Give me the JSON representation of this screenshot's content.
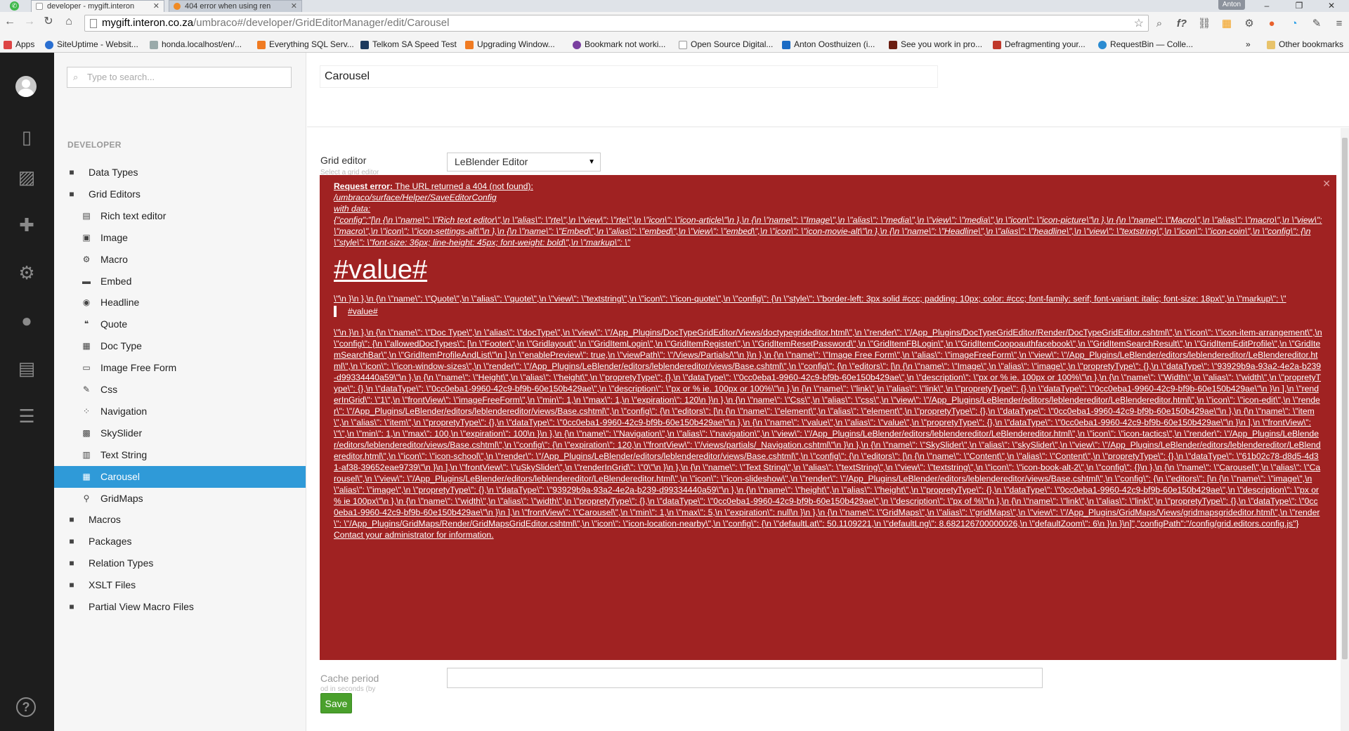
{
  "browser": {
    "tabs": [
      {
        "title": "developer - mygift.interon"
      },
      {
        "title": "404 error when using ren"
      }
    ],
    "user": "Anton",
    "url_host": "mygift.interon.co.za",
    "url_path": "/umbraco#/developer/GridEditorManager/edit/Carousel",
    "bookmarks": [
      "Apps",
      "SiteUptime - Websit...",
      "honda.localhost/en/...",
      "Everything SQL Serv...",
      "Telkom SA Speed Test",
      "Upgrading Window...",
      "Bookmark not worki...",
      "Open Source Digital...",
      "Anton Oosthuizen (i...",
      "See you work in pro...",
      "Defragmenting your...",
      "RequestBin — Colle...",
      "»",
      "Other bookmarks"
    ]
  },
  "search": {
    "placeholder": "Type to search..."
  },
  "tree": {
    "title": "DEVELOPER",
    "items": [
      {
        "label": "Data Types",
        "icon": "folder-icon",
        "level": 0
      },
      {
        "label": "Grid Editors",
        "icon": "folder-icon",
        "level": 0
      },
      {
        "label": "Rich text editor",
        "icon": "article-icon",
        "level": 1
      },
      {
        "label": "Image",
        "icon": "picture-icon",
        "level": 1
      },
      {
        "label": "Macro",
        "icon": "settings-icon",
        "level": 1
      },
      {
        "label": "Embed",
        "icon": "movie-icon",
        "level": 1
      },
      {
        "label": "Headline",
        "icon": "coin-icon",
        "level": 1
      },
      {
        "label": "Quote",
        "icon": "quote-icon",
        "level": 1
      },
      {
        "label": "Doc Type",
        "icon": "arrangement-icon",
        "level": 1
      },
      {
        "label": "Image Free Form",
        "icon": "window-sizes-icon",
        "level": 1
      },
      {
        "label": "Css",
        "icon": "edit-icon",
        "level": 1
      },
      {
        "label": "Navigation",
        "icon": "tactics-icon",
        "level": 1
      },
      {
        "label": "SkySlider",
        "icon": "school-icon",
        "level": 1
      },
      {
        "label": "Text String",
        "icon": "book-icon",
        "level": 1
      },
      {
        "label": "Carousel",
        "icon": "slideshow-icon",
        "level": 1,
        "selected": true
      },
      {
        "label": "GridMaps",
        "icon": "location-icon",
        "level": 1
      },
      {
        "label": "Macros",
        "icon": "folder-icon",
        "level": 0
      },
      {
        "label": "Packages",
        "icon": "folder-icon",
        "level": 0
      },
      {
        "label": "Relation Types",
        "icon": "folder-icon",
        "level": 0
      },
      {
        "label": "XSLT Files",
        "icon": "folder-icon",
        "level": 0
      },
      {
        "label": "Partial View Macro Files",
        "icon": "folder-icon",
        "level": 0
      }
    ]
  },
  "editor": {
    "name": "Carousel",
    "grid_editor_label": "Grid editor",
    "grid_editor_desc": "Select a grid editor",
    "grid_editor_value": "LeBlender Editor",
    "cache_label": "Cache period",
    "cache_desc": "od in seconds (by",
    "save_label": "Save"
  },
  "error": {
    "heading": "Request error:",
    "heading_rest": " The URL returned a 404 (not found):",
    "url": "/umbraco/surface/Helper/SaveEditorConfig",
    "with_data": "with data:",
    "body1": "{\"config\":\"[\\n {\\n \\\"name\\\": \\\"Rich text editor\\\",\\n \\\"alias\\\": \\\"rte\\\",\\n \\\"view\\\": \\\"rte\\\",\\n \\\"icon\\\": \\\"icon-article\\\"\\n },\\n {\\n \\\"name\\\": \\\"Image\\\",\\n \\\"alias\\\": \\\"media\\\",\\n \\\"view\\\": \\\"media\\\",\\n \\\"icon\\\": \\\"icon-picture\\\"\\n },\\n {\\n \\\"name\\\": \\\"Macro\\\",\\n \\\"alias\\\": \\\"macro\\\",\\n \\\"view\\\": \\\"macro\\\",\\n \\\"icon\\\": \\\"icon-settings-alt\\\"\\n },\\n {\\n \\\"name\\\": \\\"Embed\\\",\\n \\\"alias\\\": \\\"embed\\\",\\n \\\"view\\\": \\\"embed\\\",\\n \\\"icon\\\": \\\"icon-movie-alt\\\"\\n },\\n {\\n \\\"name\\\": \\\"Headline\\\",\\n \\\"alias\\\": \\\"headline\\\",\\n \\\"view\\\": \\\"textstring\\\",\\n \\\"icon\\\": \\\"icon-coin\\\",\\n \\\"config\\\": {\\n \\\"style\\\": \\\"font-size: 36px; line-height: 45px; font-weight: bold\\\",\\n \\\"markup\\\": \\\"",
    "big_value": "#value#",
    "body2": "\\\"\\n }\\n },\\n {\\n \\\"name\\\": \\\"Quote\\\",\\n \\\"alias\\\": \\\"quote\\\",\\n \\\"view\\\": \\\"textstring\\\",\\n \\\"icon\\\": \\\"icon-quote\\\",\\n \\\"config\\\": {\\n \\\"style\\\": \\\"border-left: 3px solid #ccc; padding: 10px; color: #ccc; font-family: serif; font-variant: italic; font-size: 18px\\\",\\n \\\"markup\\\": \\\"",
    "quote_value": "#value#",
    "body3": "\\\"\\n }\\n },\\n {\\n \\\"name\\\": \\\"Doc Type\\\",\\n \\\"alias\\\": \\\"docType\\\",\\n \\\"view\\\": \\\"/App_Plugins/DocTypeGridEditor/Views/doctypegrideditor.html\\\",\\n \\\"render\\\": \\\"/App_Plugins/DocTypeGridEditor/Render/DocTypeGridEditor.cshtml\\\",\\n \\\"icon\\\": \\\"icon-item-arrangement\\\",\\n \\\"config\\\": {\\n \\\"allowedDocTypes\\\": [\\n \\\"Footer\\\",\\n \\\"Gridlayout\\\",\\n \\\"GridItemLogin\\\",\\n \\\"GridItemRegister\\\",\\n \\\"GridItemResetPassword\\\",\\n \\\"GridItemFBLogin\\\",\\n \\\"GridItemCoopoauthfacebook\\\",\\n \\\"GridItemSearchResult\\\",\\n \\\"GridItemEditProfile\\\",\\n \\\"GridItemSearchBar\\\",\\n \\\"GridItemProfileAndList\\\"\\n ],\\n \\\"enablePreview\\\": true,\\n \\\"viewPath\\\": \\\"/Views/Partials/\\\"\\n }\\n },\\n {\\n \\\"name\\\": \\\"Image Free Form\\\",\\n \\\"alias\\\": \\\"imageFreeForm\\\",\\n \\\"view\\\": \\\"/App_Plugins/LeBlender/editors/leblendereditor/LeBlendereditor.html\\\",\\n \\\"icon\\\": \\\"icon-window-sizes\\\",\\n \\\"render\\\": \\\"/App_Plugins/LeBlender/editors/leblendereditor/views/Base.cshtml\\\",\\n \\\"config\\\": {\\n \\\"editors\\\": [\\n {\\n \\\"name\\\": \\\"Image\\\",\\n \\\"alias\\\": \\\"image\\\",\\n \\\"propretyType\\\": {},\\n \\\"dataType\\\": \\\"93929b9a-93a2-4e2a-b239-d99334440a59\\\"\\n },\\n {\\n \\\"name\\\": \\\"Height\\\",\\n \\\"alias\\\": \\\"height\\\",\\n \\\"propretyType\\\": {},\\n \\\"dataType\\\": \\\"0cc0eba1-9960-42c9-bf9b-60e150b429ae\\\",\\n \\\"description\\\": \\\"px or % ie. 100px or 100%\\\"\\n },\\n {\\n \\\"name\\\": \\\"Width\\\",\\n \\\"alias\\\": \\\"width\\\",\\n \\\"propretyType\\\": {},\\n \\\"dataType\\\": \\\"0cc0eba1-9960-42c9-bf9b-60e150b429ae\\\",\\n \\\"description\\\": \\\"px or % ie. 100px or 100%\\\"\\n },\\n {\\n \\\"name\\\": \\\"link\\\",\\n \\\"alias\\\": \\\"link\\\",\\n \\\"propretyType\\\": {},\\n \\\"dataType\\\": \\\"0cc0eba1-9960-42c9-bf9b-60e150b429ae\\\"\\n }\\n ],\\n \\\"renderInGrid\\\": \\\"1\\\",\\n \\\"frontView\\\": \\\"imageFreeForm\\\",\\n \\\"min\\\": 1,\\n \\\"max\\\": 1,\\n \\\"expiration\\\": 120\\n }\\n },\\n {\\n \\\"name\\\": \\\"Css\\\",\\n \\\"alias\\\": \\\"css\\\",\\n \\\"view\\\": \\\"/App_Plugins/LeBlender/editors/leblendereditor/LeBlendereditor.html\\\",\\n \\\"icon\\\": \\\"icon-edit\\\",\\n \\\"render\\\": \\\"/App_Plugins/LeBlender/editors/leblendereditor/views/Base.cshtml\\\",\\n \\\"config\\\": {\\n \\\"editors\\\": [\\n {\\n \\\"name\\\": \\\"element\\\",\\n \\\"alias\\\": \\\"element\\\",\\n \\\"propretyType\\\": {},\\n \\\"dataType\\\": \\\"0cc0eba1-9960-42c9-bf9b-60e150b429ae\\\"\\n },\\n {\\n \\\"name\\\": \\\"item\\\",\\n \\\"alias\\\": \\\"item\\\",\\n \\\"propretyType\\\": {},\\n \\\"dataType\\\": \\\"0cc0eba1-9960-42c9-bf9b-60e150b429ae\\\"\\n },\\n {\\n \\\"name\\\": \\\"value\\\",\\n \\\"alias\\\": \\\"value\\\",\\n \\\"propretyType\\\": {},\\n \\\"dataType\\\": \\\"0cc0eba1-9960-42c9-bf9b-60e150b429ae\\\"\\n }\\n ],\\n \\\"frontView\\\": \\\"\\\",\\n \\\"min\\\": 1,\\n \\\"max\\\": 100,\\n \\\"expiration\\\": 100\\n }\\n },\\n {\\n \\\"name\\\": \\\"Navigation\\\",\\n \\\"alias\\\": \\\"navigation\\\",\\n \\\"view\\\": \\\"/App_Plugins/LeBlender/editors/leblendereditor/LeBlendereditor.html\\\",\\n \\\"icon\\\": \\\"icon-tactics\\\",\\n \\\"render\\\": \\\"/App_Plugins/LeBlender/editors/leblendereditor/views/Base.cshtml\\\",\\n \\\"config\\\": {\\n \\\"expiration\\\": 120,\\n \\\"frontView\\\": \\\"/views/partials/_Navigation.cshtml\\\"\\n }\\n },\\n {\\n \\\"name\\\": \\\"SkySlider\\\",\\n \\\"alias\\\": \\\"skySlider\\\",\\n \\\"view\\\": \\\"/App_Plugins/LeBlender/editors/leblendereditor/LeBlendereditor.html\\\",\\n \\\"icon\\\": \\\"icon-school\\\",\\n \\\"render\\\": \\\"/App_Plugins/LeBlender/editors/leblendereditor/views/Base.cshtml\\\",\\n \\\"config\\\": {\\n \\\"editors\\\": [\\n {\\n \\\"name\\\": \\\"Content\\\",\\n \\\"alias\\\": \\\"Content\\\",\\n \\\"propretyType\\\": {},\\n \\\"dataType\\\": \\\"61b02c78-d8d5-4d31-af38-39652eae9739\\\"\\n }\\n ],\\n \\\"frontView\\\": \\\"uSkySlider\\\",\\n \\\"renderInGrid\\\": \\\"0\\\"\\n }\\n },\\n {\\n \\\"name\\\": \\\"Text String\\\",\\n \\\"alias\\\": \\\"textString\\\",\\n \\\"view\\\": \\\"textstring\\\",\\n \\\"icon\\\": \\\"icon-book-alt-2\\\",\\n \\\"config\\\": {}\\n },\\n {\\n \\\"name\\\": \\\"Carousel\\\",\\n \\\"alias\\\": \\\"Carousel\\\",\\n \\\"view\\\": \\\"/App_Plugins/LeBlender/editors/leblendereditor/LeBlendereditor.html\\\",\\n \\\"icon\\\": \\\"icon-slideshow\\\",\\n \\\"render\\\": \\\"/App_Plugins/LeBlender/editors/leblendereditor/views/Base.cshtml\\\",\\n \\\"config\\\": {\\n \\\"editors\\\": [\\n {\\n \\\"name\\\": \\\"image\\\",\\n \\\"alias\\\": \\\"image\\\",\\n \\\"propretyType\\\": {},\\n \\\"dataType\\\": \\\"93929b9a-93a2-4e2a-b239-d99334440a59\\\"\\n },\\n {\\n \\\"name\\\": \\\"height\\\",\\n \\\"alias\\\": \\\"height\\\",\\n \\\"propretyType\\\": {},\\n \\\"dataType\\\": \\\"0cc0eba1-9960-42c9-bf9b-60e150b429ae\\\",\\n \\\"description\\\": \\\"px or % ie 100px\\\"\\n },\\n {\\n \\\"name\\\": \\\"width\\\",\\n \\\"alias\\\": \\\"width\\\",\\n \\\"propretyType\\\": {},\\n \\\"dataType\\\": \\\"0cc0eba1-9960-42c9-bf9b-60e150b429ae\\\",\\n \\\"description\\\": \\\"px of %\\\"\\n },\\n {\\n \\\"name\\\": \\\"link\\\",\\n \\\"alias\\\": \\\"link\\\",\\n \\\"propretyType\\\": {},\\n \\\"dataType\\\": \\\"0cc0eba1-9960-42c9-bf9b-60e150b429ae\\\"\\n }\\n ],\\n \\\"frontView\\\": \\\"Carousel\\\",\\n \\\"min\\\": 1,\\n \\\"max\\\": 5,\\n \\\"expiration\\\": null\\n }\\n },\\n {\\n \\\"name\\\": \\\"GridMaps\\\",\\n \\\"alias\\\": \\\"gridMaps\\\",\\n \\\"view\\\": \\\"/App_Plugins/GridMaps/Views/gridmapsgrideditor.html\\\",\\n \\\"render\\\": \\\"/App_Plugins/GridMaps/Render/GridMapsGridEditor.cshtml\\\",\\n \\\"icon\\\": \\\"icon-location-nearby\\\",\\n \\\"config\\\": {\\n \\\"defaultLat\\\": 50.1109221,\\n \\\"defaultLng\\\": 8.682126700000026,\\n \\\"defaultZoom\\\": 6\\n }\\n }\\n]\",\"configPath\":\"/config/grid.editors.config.js\"}",
    "footer": "Contact your administrator for information."
  }
}
